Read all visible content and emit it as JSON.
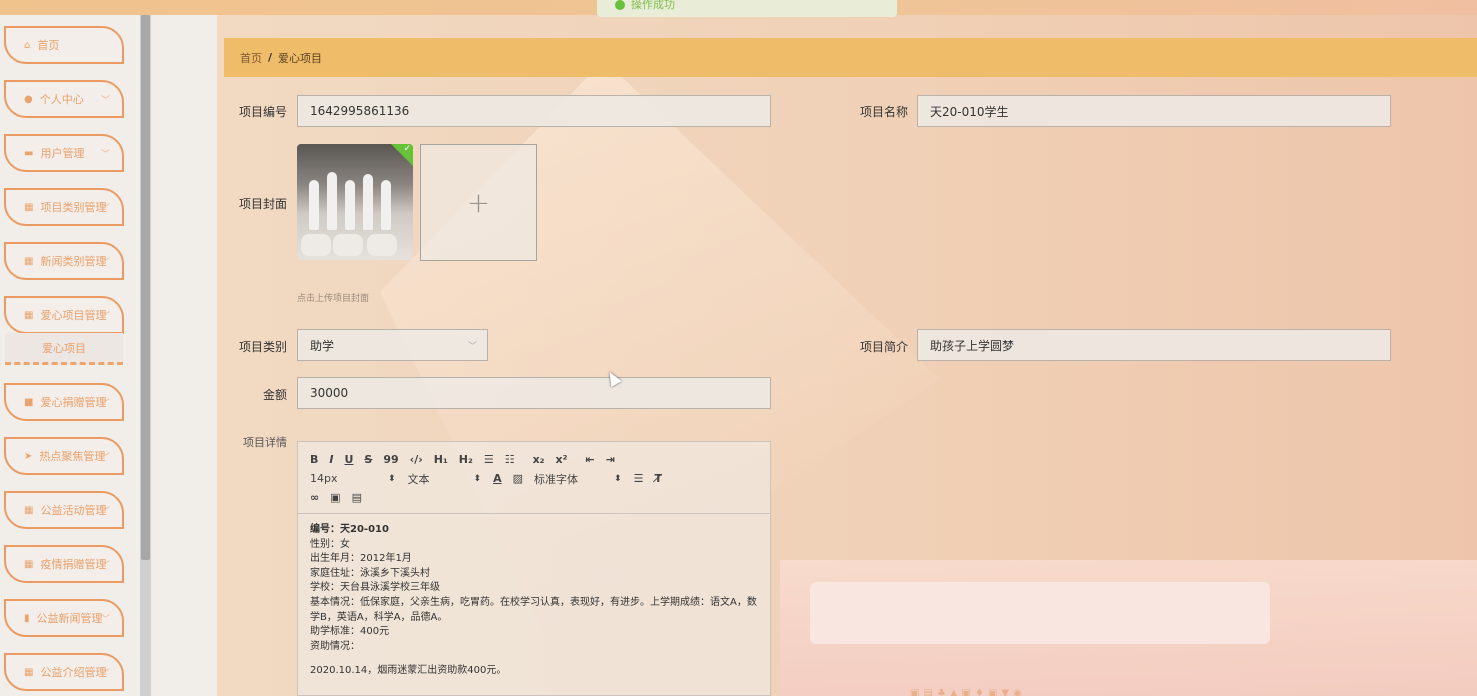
{
  "toast": {
    "message": "操作成功"
  },
  "sidebar": {
    "items": [
      {
        "label": "首页",
        "icon": "home-icon",
        "glyph": "⌂",
        "chevron": false
      },
      {
        "label": "个人中心",
        "icon": "user-icon",
        "glyph": "●",
        "chevron": true
      },
      {
        "label": "用户管理",
        "icon": "card-icon",
        "glyph": "▬",
        "chevron": true
      },
      {
        "label": "项目类别管理",
        "icon": "grid-icon",
        "glyph": "▦",
        "chevron": true
      },
      {
        "label": "新闻类别管理",
        "icon": "grid-icon",
        "glyph": "▦",
        "chevron": true
      },
      {
        "label": "爱心项目管理",
        "icon": "grid-icon",
        "glyph": "▦",
        "chevron": true
      },
      {
        "label": "爱心捐赠管理",
        "icon": "box-icon",
        "glyph": "■",
        "chevron": true
      },
      {
        "label": "热点聚焦管理",
        "icon": "send-icon",
        "glyph": "➤",
        "chevron": true
      },
      {
        "label": "公益活动管理",
        "icon": "grid-icon",
        "glyph": "▦",
        "chevron": true
      },
      {
        "label": "疫情捐赠管理",
        "icon": "grid-icon",
        "glyph": "▦",
        "chevron": true
      },
      {
        "label": "公益新闻管理",
        "icon": "bar-chart-icon",
        "glyph": "▮",
        "chevron": true
      },
      {
        "label": "公益介绍管理",
        "icon": "grid-icon",
        "glyph": "▦",
        "chevron": true
      }
    ],
    "submenu_label": "爱心项目"
  },
  "breadcrumb": {
    "home": "首页",
    "separator": "/",
    "current": "爱心项目"
  },
  "form": {
    "code_label": "项目编号",
    "code_value": "1642995861136",
    "name_label": "项目名称",
    "name_value": "天20-010学生",
    "cover_label": "项目封面",
    "upload_plus": "+",
    "cover_hint": "点击上传项目封面",
    "category_label": "项目类别",
    "category_value": "助学",
    "intro_label": "项目简介",
    "intro_value": "助孩子上学圆梦",
    "amount_label": "金额",
    "amount_value": "30000",
    "detail_label": "项目详情"
  },
  "editor": {
    "toolbar_row1": [
      "B",
      "I",
      "U",
      "S",
      "99",
      "‹/›",
      "H₁",
      "H₂",
      "☰",
      "☷",
      "x₂",
      "x²",
      "⇤",
      "⇥"
    ],
    "font_size": "14px",
    "text_type": "文本",
    "font_family": "标准字体",
    "lines": [
      "编号：天20-010",
      "性别：女",
      "出生年月：2012年1月",
      "家庭住址：泳溪乡下溪头村",
      "学校：天台县泳溪学校三年级",
      "基本情况：低保家庭，父亲生病，吃胃药。在校学习认真，表现好，有进步。上学期成绩：语文A，数学B，英语A，科学A，品德A。",
      "助学标准：400元",
      "资助情况：",
      "2020.10.14，烟雨迷蒙汇出资助款400元。"
    ]
  },
  "colors": {
    "accent": "#efbd6a",
    "menu_border": "#eb9a64",
    "success": "#67c23a"
  }
}
